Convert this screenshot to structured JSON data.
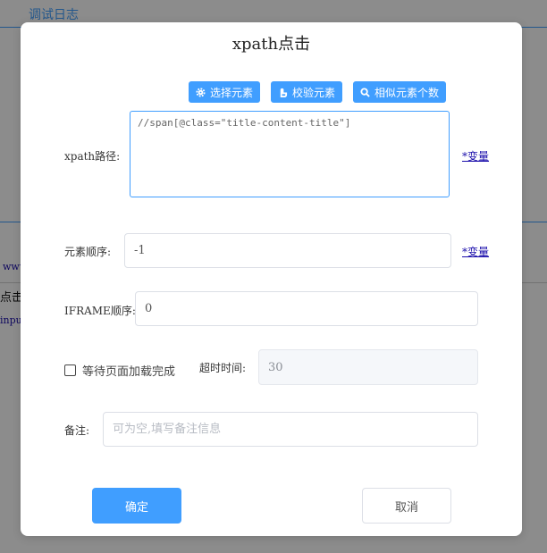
{
  "background": {
    "tab_label": "调试日志",
    "fragment_1": "点击",
    "fragment_2": "www.",
    "fragment_3": "input"
  },
  "dialog": {
    "title": "xpath点击",
    "toolbar": {
      "select_element": "选择元素",
      "verify_element": "校验元素",
      "similar_count": "相似元素个数"
    },
    "xpath": {
      "label": "xpath路径:",
      "value": "//span[@class=\"title-content-title\"]",
      "var_link": "*变量"
    },
    "element_order": {
      "label": "元素顺序:",
      "value": "-1",
      "var_link": "*变量"
    },
    "iframe_order": {
      "label": "IFRAME顺序:",
      "value": "0"
    },
    "wait_load": {
      "label": "等待页面加载完成",
      "checked": false
    },
    "timeout": {
      "label": "超时时间:",
      "value": "30"
    },
    "remark": {
      "label": "备注:",
      "placeholder": "可为空,填写备注信息"
    },
    "confirm_label": "确定",
    "cancel_label": "取消"
  },
  "colors": {
    "accent": "#409eff",
    "link": "#1a0dab"
  }
}
